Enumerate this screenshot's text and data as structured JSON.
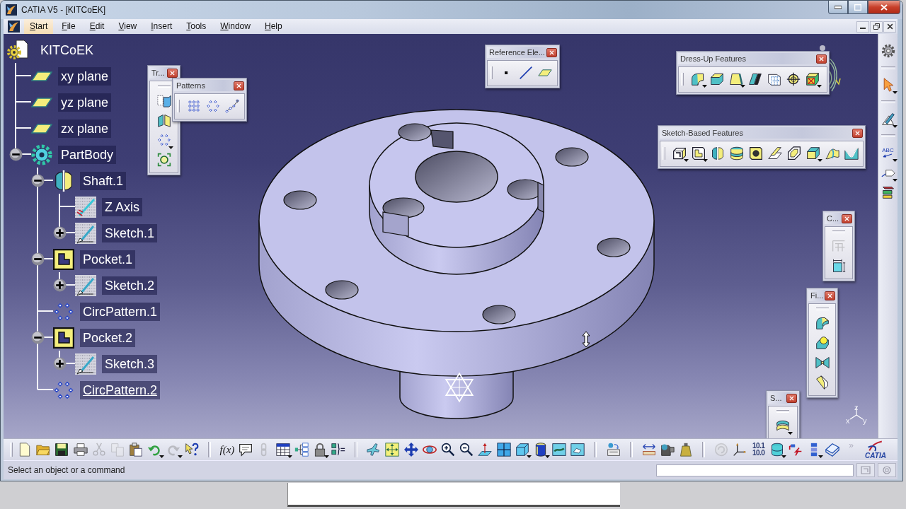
{
  "window": {
    "title": "CATIA V5 - [KITCoEK]"
  },
  "menu_bar": {
    "items": [
      {
        "label": "Start",
        "selected": true
      },
      {
        "label": "File",
        "selected": false
      },
      {
        "label": "Edit",
        "selected": false
      },
      {
        "label": "View",
        "selected": false
      },
      {
        "label": "Insert",
        "selected": false
      },
      {
        "label": "Tools",
        "selected": false
      },
      {
        "label": "Window",
        "selected": false
      },
      {
        "label": "Help",
        "selected": false
      }
    ]
  },
  "tree": {
    "label": "KITCoEK",
    "kind": "part",
    "children": [
      {
        "label": "xy plane",
        "kind": "plane"
      },
      {
        "label": "yz plane",
        "kind": "plane"
      },
      {
        "label": "zx plane",
        "kind": "plane"
      },
      {
        "label": "PartBody",
        "kind": "body",
        "expanded": true,
        "children": [
          {
            "label": "Shaft.1",
            "kind": "shaft",
            "expanded": true,
            "in_work": false,
            "children": [
              {
                "label": "Z Axis",
                "kind": "axis"
              },
              {
                "label": "Sketch.1",
                "kind": "sketch",
                "expanded": false
              }
            ]
          },
          {
            "label": "Pocket.1",
            "kind": "pocket",
            "expanded": true,
            "in_work": false,
            "children": [
              {
                "label": "Sketch.2",
                "kind": "sketch",
                "expanded": false
              }
            ]
          },
          {
            "label": "CircPattern.1",
            "kind": "pattern",
            "in_work": false
          },
          {
            "label": "Pocket.2",
            "kind": "pocket",
            "expanded": true,
            "in_work": false,
            "children": [
              {
                "label": "Sketch.3",
                "kind": "sketch",
                "expanded": false
              }
            ]
          },
          {
            "label": "CircPattern.2",
            "kind": "pattern",
            "in_work": true
          }
        ]
      }
    ]
  },
  "floating_toolbars": [
    {
      "title": "Tr...",
      "tools": [
        {
          "kind": "blocks",
          "dropdown": false
        },
        {
          "kind": "mirror",
          "dropdown": false
        },
        {
          "kind": "dotring",
          "dropdown": true
        },
        {
          "kind": "scale",
          "dropdown": false
        }
      ]
    },
    {
      "title": "Patterns",
      "tools": [
        {
          "kind": "dotgrid",
          "dropdown": false
        },
        {
          "kind": "dotring",
          "dropdown": false
        },
        {
          "kind": "dotcurve",
          "dropdown": false
        }
      ]
    },
    {
      "title": "Reference Ele...",
      "tools": [
        {
          "kind": "point",
          "dropdown": false
        },
        {
          "kind": "line",
          "dropdown": false
        },
        {
          "kind": "plane",
          "dropdown": false
        }
      ]
    },
    {
      "title": "Dress-Up Features",
      "tools": [
        {
          "kind": "fillet",
          "dropdown": true
        },
        {
          "kind": "chamfer",
          "dropdown": false
        },
        {
          "kind": "draft",
          "dropdown": true
        },
        {
          "kind": "shell",
          "dropdown": false
        },
        {
          "kind": "thickness",
          "dropdown": false
        },
        {
          "kind": "thread",
          "dropdown": false
        },
        {
          "kind": "removeface",
          "dropdown": true
        }
      ]
    },
    {
      "title": "Sketch-Based Features",
      "tools": [
        {
          "kind": "pad",
          "dropdown": true
        },
        {
          "kind": "pocket",
          "dropdown": true
        },
        {
          "kind": "shaft",
          "dropdown": false
        },
        {
          "kind": "groove",
          "dropdown": false
        },
        {
          "kind": "hole",
          "dropdown": false
        },
        {
          "kind": "rib",
          "dropdown": false
        },
        {
          "kind": "slot",
          "dropdown": false
        },
        {
          "kind": "stiffener",
          "dropdown": true
        },
        {
          "kind": "loft",
          "dropdown": false
        },
        {
          "kind": "removeloft",
          "dropdown": false
        }
      ]
    },
    {
      "title": "C...",
      "tools": [
        {
          "kind": "constraints",
          "dropdown": false,
          "disabled": true
        },
        {
          "kind": "dimension",
          "dropdown": false,
          "disabled": false
        }
      ]
    },
    {
      "title": "Fi...",
      "tools": [
        {
          "kind": "edgefillet",
          "dropdown": false
        },
        {
          "kind": "varfillet",
          "dropdown": false
        },
        {
          "kind": "facefillet",
          "dropdown": false
        },
        {
          "kind": "tritangent",
          "dropdown": false
        }
      ]
    },
    {
      "title": "S...",
      "tools": [
        {
          "kind": "split",
          "dropdown": true
        }
      ]
    }
  ],
  "right_toolbar": {
    "groups": [
      [
        {
          "kind": "gear",
          "dropdown": false
        }
      ],
      [
        {
          "kind": "pointer",
          "dropdown": true
        }
      ],
      [
        {
          "kind": "sketcher",
          "dropdown": true
        }
      ],
      [
        {
          "kind": "abc",
          "label": "ABC",
          "dropdown": true
        },
        {
          "kind": "flag",
          "dropdown": true
        },
        {
          "kind": "stack",
          "dropdown": false
        }
      ]
    ]
  },
  "viewport": {
    "axis_labels": [
      "z",
      "x",
      "y"
    ]
  },
  "standard_toolbar": {
    "groups": [
      [
        {
          "kind": "new",
          "dropdown": false,
          "disabled": false
        },
        {
          "kind": "open",
          "dropdown": false,
          "disabled": false
        },
        {
          "kind": "save",
          "dropdown": false,
          "disabled": false
        },
        {
          "kind": "print",
          "dropdown": false,
          "disabled": false
        },
        {
          "kind": "cut",
          "dropdown": false,
          "disabled": true
        },
        {
          "kind": "copy",
          "dropdown": false,
          "disabled": true
        },
        {
          "kind": "paste",
          "dropdown": false,
          "disabled": false
        },
        {
          "kind": "undo",
          "dropdown": true,
          "disabled": false
        },
        {
          "kind": "redo",
          "dropdown": true,
          "disabled": true
        },
        {
          "kind": "whatsthis",
          "dropdown": false,
          "disabled": false
        }
      ],
      [
        {
          "kind": "fx",
          "label": "f(x)",
          "dropdown": false,
          "disabled": false
        },
        {
          "kind": "comment",
          "dropdown": false,
          "disabled": false
        },
        {
          "kind": "chain",
          "dropdown": false,
          "disabled": true
        },
        {
          "kind": "table",
          "dropdown": true,
          "disabled": false
        },
        {
          "kind": "tree",
          "dropdown": false,
          "disabled": false
        },
        {
          "kind": "lock",
          "dropdown": true,
          "disabled": false
        },
        {
          "kind": "formula",
          "dropdown": false,
          "disabled": false
        }
      ],
      [
        {
          "kind": "fly",
          "dropdown": false
        },
        {
          "kind": "fitall",
          "dropdown": false
        },
        {
          "kind": "pan",
          "dropdown": false
        },
        {
          "kind": "rotate",
          "dropdown": false
        },
        {
          "kind": "zoomin",
          "dropdown": false
        },
        {
          "kind": "zoomout",
          "dropdown": false
        },
        {
          "kind": "normal",
          "dropdown": false
        },
        {
          "kind": "multiview",
          "dropdown": false
        },
        {
          "kind": "iso",
          "dropdown": true
        },
        {
          "kind": "shading",
          "dropdown": true
        },
        {
          "kind": "hideshow",
          "dropdown": false
        },
        {
          "kind": "swap",
          "dropdown": false
        }
      ],
      [
        {
          "kind": "catalog",
          "dropdown": false
        }
      ],
      [
        {
          "kind": "measure",
          "dropdown": false
        },
        {
          "kind": "measureitem",
          "dropdown": false
        },
        {
          "kind": "inertia",
          "dropdown": false
        }
      ],
      [
        {
          "kind": "update",
          "dropdown": false,
          "disabled": true
        },
        {
          "kind": "axis",
          "dropdown": false,
          "disabled": false
        },
        {
          "kind": "units",
          "lines": [
            "10.1",
            "10.0"
          ],
          "dropdown": false,
          "disabled": false
        },
        {
          "kind": "sheets",
          "dropdown": true,
          "disabled": false
        },
        {
          "kind": "redcut",
          "dropdown": false,
          "disabled": false
        },
        {
          "kind": "list",
          "dropdown": true,
          "disabled": false
        },
        {
          "kind": "book",
          "dropdown": false,
          "disabled": false
        }
      ]
    ],
    "more": "»",
    "logo": "CATIA"
  },
  "status_bar": {
    "message": "Select an object or a command"
  }
}
